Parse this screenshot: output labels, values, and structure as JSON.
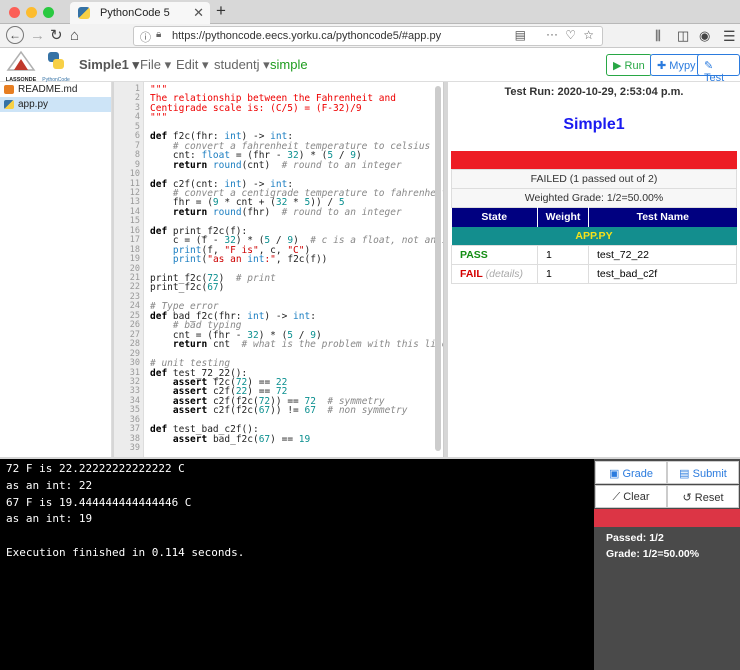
{
  "browser": {
    "tab_title": "PythonCode 5",
    "url": "https://pythoncode.eecs.yorku.ca/pythoncode5/#app.py"
  },
  "app": {
    "logo_text": "LASSONDE",
    "logo2_text": "PythonCode",
    "project_menu": "Simple1",
    "file_menu": "File",
    "edit_menu": "Edit",
    "user_menu": "studentj",
    "mode_label": "simple",
    "run_label": "Run",
    "mypy_label": "Mypy",
    "test_label": "Test"
  },
  "files": [
    {
      "name": "README.md",
      "type": "markdown"
    },
    {
      "name": "app.py",
      "type": "python",
      "selected": true
    }
  ],
  "editor": {
    "lines": [
      "\"\"\"",
      "The relationship between the Fahrenheit and",
      "Centigrade scale is: (C/5) = (F-32)/9",
      "\"\"\"",
      "",
      "def f2c(fhr: int) -> int:",
      "    # convert a fahrenheit temperature to celsius",
      "    cnt: float = (fhr - 32) * (5 / 9)",
      "    return round(cnt)  # round to an integer",
      "",
      "def c2f(cnt: int) -> int:",
      "    # convert a centigrade temperature to fahrenheit",
      "    fhr = (9 * cnt + (32 * 5)) / 5",
      "    return round(fhr)  # round to an integer",
      "",
      "def print_f2c(f):",
      "    c = (f - 32) * (5 / 9)  # c is a float, not an in",
      "    print(f, \"F is\", c, \"C\")",
      "    print(\"as an int:\", f2c(f))",
      "",
      "print_f2c(72)  # print",
      "print_f2c(67)",
      "",
      "# Type error",
      "def bad_f2c(fhr: int) -> int:",
      "    # bad typing",
      "    cnt = (fhr - 32) * (5 / 9)",
      "    return cnt  # what is the problem with this line?",
      "",
      "# unit testing",
      "def test_72_22():",
      "    assert f2c(72) == 22",
      "    assert c2f(22) == 72",
      "    assert c2f(f2c(72)) == 72  # symmetry",
      "    assert c2f(f2c(67)) != 67  # non symmetry",
      "",
      "def test_bad_c2f():",
      "    assert bad_f2c(67) == 19",
      ""
    ]
  },
  "results": {
    "run_header": "Test Run: 2020-10-29, 2:53:04 p.m.",
    "project_title": "Simple1",
    "status_text": "FAILED (1 passed out of 2)",
    "weighted_grade": "Weighted Grade: 1/2=50.00%",
    "columns": [
      "State",
      "Weight",
      "Test Name"
    ],
    "group_name": "APP.PY",
    "rows": [
      {
        "state": "PASS",
        "details": "",
        "weight": "1",
        "name": "test_72_22"
      },
      {
        "state": "FAIL",
        "details": "(details)",
        "weight": "1",
        "name": "test_bad_c2f"
      }
    ]
  },
  "terminal": {
    "lines": [
      "72 F is 22.22222222222222 C",
      "as an int: 22",
      "67 F is 19.444444444444446 C",
      "as an int: 19",
      "",
      "Execution finished in 0.114 seconds."
    ]
  },
  "panel": {
    "grade_label": "Grade",
    "submit_label": "Submit",
    "clear_label": "Clear",
    "reset_label": "Reset",
    "passed_text": "Passed: 1/2",
    "grade_text": "Grade: 1/2=50.00%"
  },
  "colors": {
    "fail_red": "#ed1c24",
    "header_navy": "#000080",
    "group_teal": "#138e8e",
    "pass_green": "#138d13",
    "keyword_blue": "#0000ff",
    "string_red": "#ee0000"
  }
}
